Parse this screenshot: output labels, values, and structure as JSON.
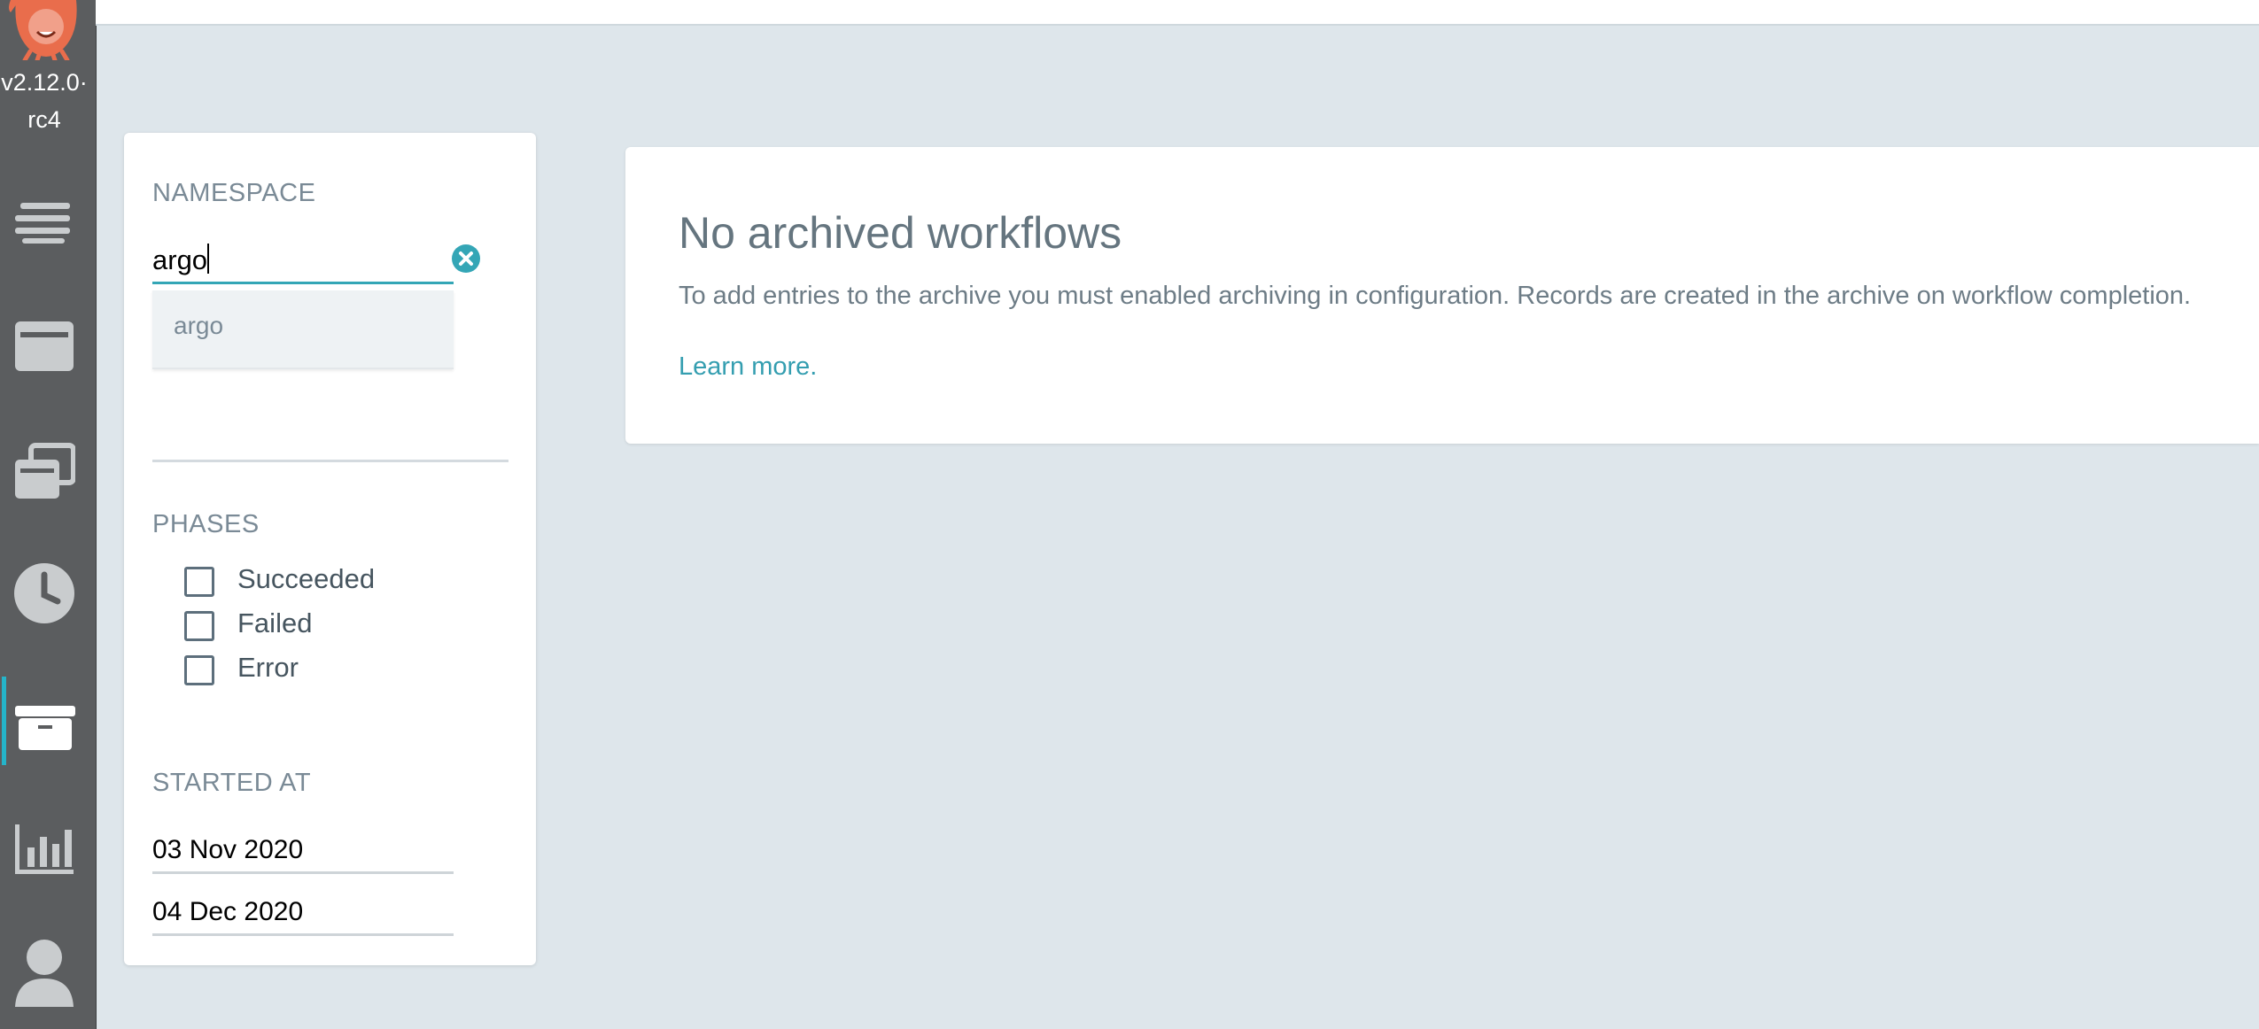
{
  "app": {
    "version": "v2.12.0-\nrc4",
    "version_line1": "v2.12.0·",
    "version_line2": "rc4"
  },
  "sidebar": {
    "items": [
      {
        "icon": "workflows-icon",
        "active": false
      },
      {
        "icon": "workflow-templates-icon",
        "active": false
      },
      {
        "icon": "cluster-workflow-templates-icon",
        "active": false
      },
      {
        "icon": "cron-workflows-icon",
        "active": false
      },
      {
        "icon": "archived-workflows-icon",
        "active": true
      },
      {
        "icon": "reports-icon",
        "active": false
      },
      {
        "icon": "user-icon",
        "active": false
      }
    ]
  },
  "filters": {
    "namespace_title": "NAMESPACE",
    "namespace_value": "argo",
    "namespace_suggestions": [
      "argo"
    ],
    "phases_title": "PHASES",
    "phases": [
      "Succeeded",
      "Failed",
      "Error"
    ],
    "started_at_title": "STARTED AT",
    "started_from": "03 Nov 2020",
    "started_to": "04 Dec 2020"
  },
  "main": {
    "title": "No archived workflows",
    "description": "To add entries to the archive you must enabled archiving in configuration. Records are created in the archive on workflow completion.",
    "link_text": "Learn more."
  },
  "colors": {
    "accent": "#34a6b6",
    "sidebar_bg": "#5b5d5f",
    "page_bg": "#dee6eb"
  }
}
